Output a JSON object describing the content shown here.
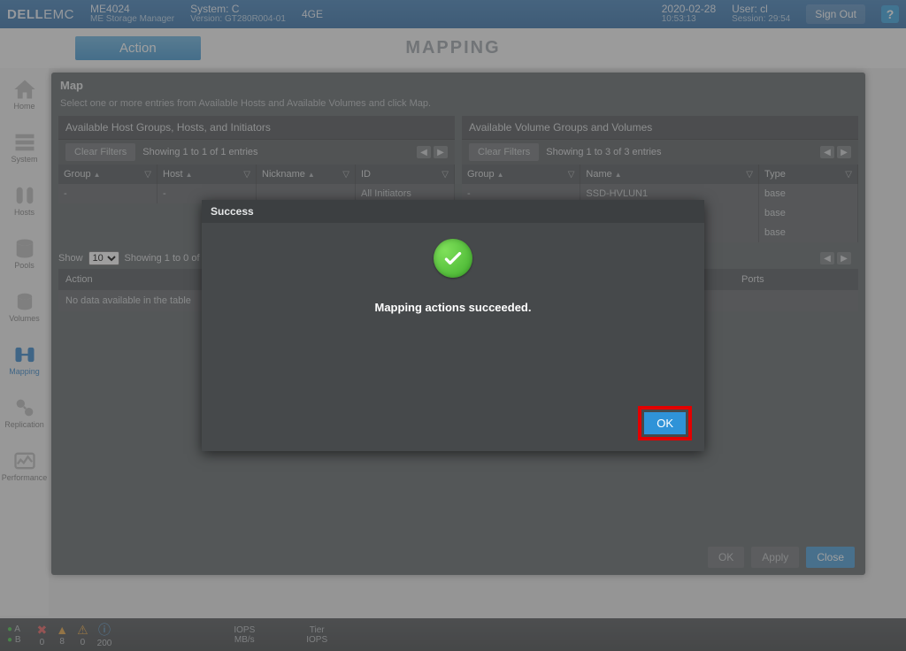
{
  "header": {
    "brand_dell": "DELL",
    "brand_emc": "EMC",
    "product": "ME4024",
    "subtitle": "ME Storage Manager",
    "system_label": "System:",
    "system_value": "C",
    "version_label": "Version:",
    "version_value": "GT280R004-01",
    "endpoint": "4GE",
    "date": "2020-02-28",
    "time": "10:53:13",
    "user_label": "User:",
    "user_value": "cl",
    "session_label": "Session:",
    "session_value": "29:54",
    "signout": "Sign Out",
    "help": "?"
  },
  "subheader": {
    "action": "Action",
    "title": "MAPPING"
  },
  "sidebar": {
    "items": [
      {
        "label": "Home"
      },
      {
        "label": "System"
      },
      {
        "label": "Hosts"
      },
      {
        "label": "Pools"
      },
      {
        "label": "Volumes"
      },
      {
        "label": "Mapping"
      },
      {
        "label": "Replication"
      },
      {
        "label": "Performance"
      }
    ]
  },
  "map_dialog": {
    "title": "Map",
    "instruction": "Select one or more entries from Available Hosts and Available Volumes and click Map.",
    "left_panel": {
      "title": "Available Host Groups, Hosts, and Initiators",
      "clear": "Clear Filters",
      "showing": "Showing 1 to 1 of 1 entries",
      "columns": [
        "Group",
        "Host",
        "Nickname",
        "ID"
      ],
      "row": {
        "group": "-",
        "host": "-",
        "nickname": "",
        "id": "All Initiators"
      }
    },
    "right_panel": {
      "title": "Available Volume Groups and Volumes",
      "clear": "Clear Filters",
      "showing": "Showing 1 to 3 of 3 entries",
      "columns": [
        "Group",
        "Name",
        "Type"
      ],
      "rows": [
        {
          "group": "-",
          "name": "SSD-HVLUN1",
          "type": "base"
        },
        {
          "group": "",
          "name": "",
          "type": "base"
        },
        {
          "group": "",
          "name": "",
          "type": "base"
        }
      ]
    },
    "show_label": "Show",
    "show_value": "10",
    "show_entries": "Showing 1 to 0 of 0 entries",
    "lower_columns": {
      "action": "Action",
      "ports": "Ports"
    },
    "lower_empty": "No data available in the table",
    "buttons": {
      "ok": "OK",
      "apply": "Apply",
      "close": "Close"
    }
  },
  "success_modal": {
    "title": "Success",
    "message": "Mapping actions succeeded.",
    "ok": "OK"
  },
  "statusbar": {
    "a": "A",
    "b": "B",
    "err_count": "0",
    "warn_count": "8",
    "alert_count": "0",
    "info_count": "200",
    "iops_label": "IOPS",
    "mbs_label": "MB/s",
    "tier_label": "Tier",
    "tier_iops": "IOPS"
  }
}
